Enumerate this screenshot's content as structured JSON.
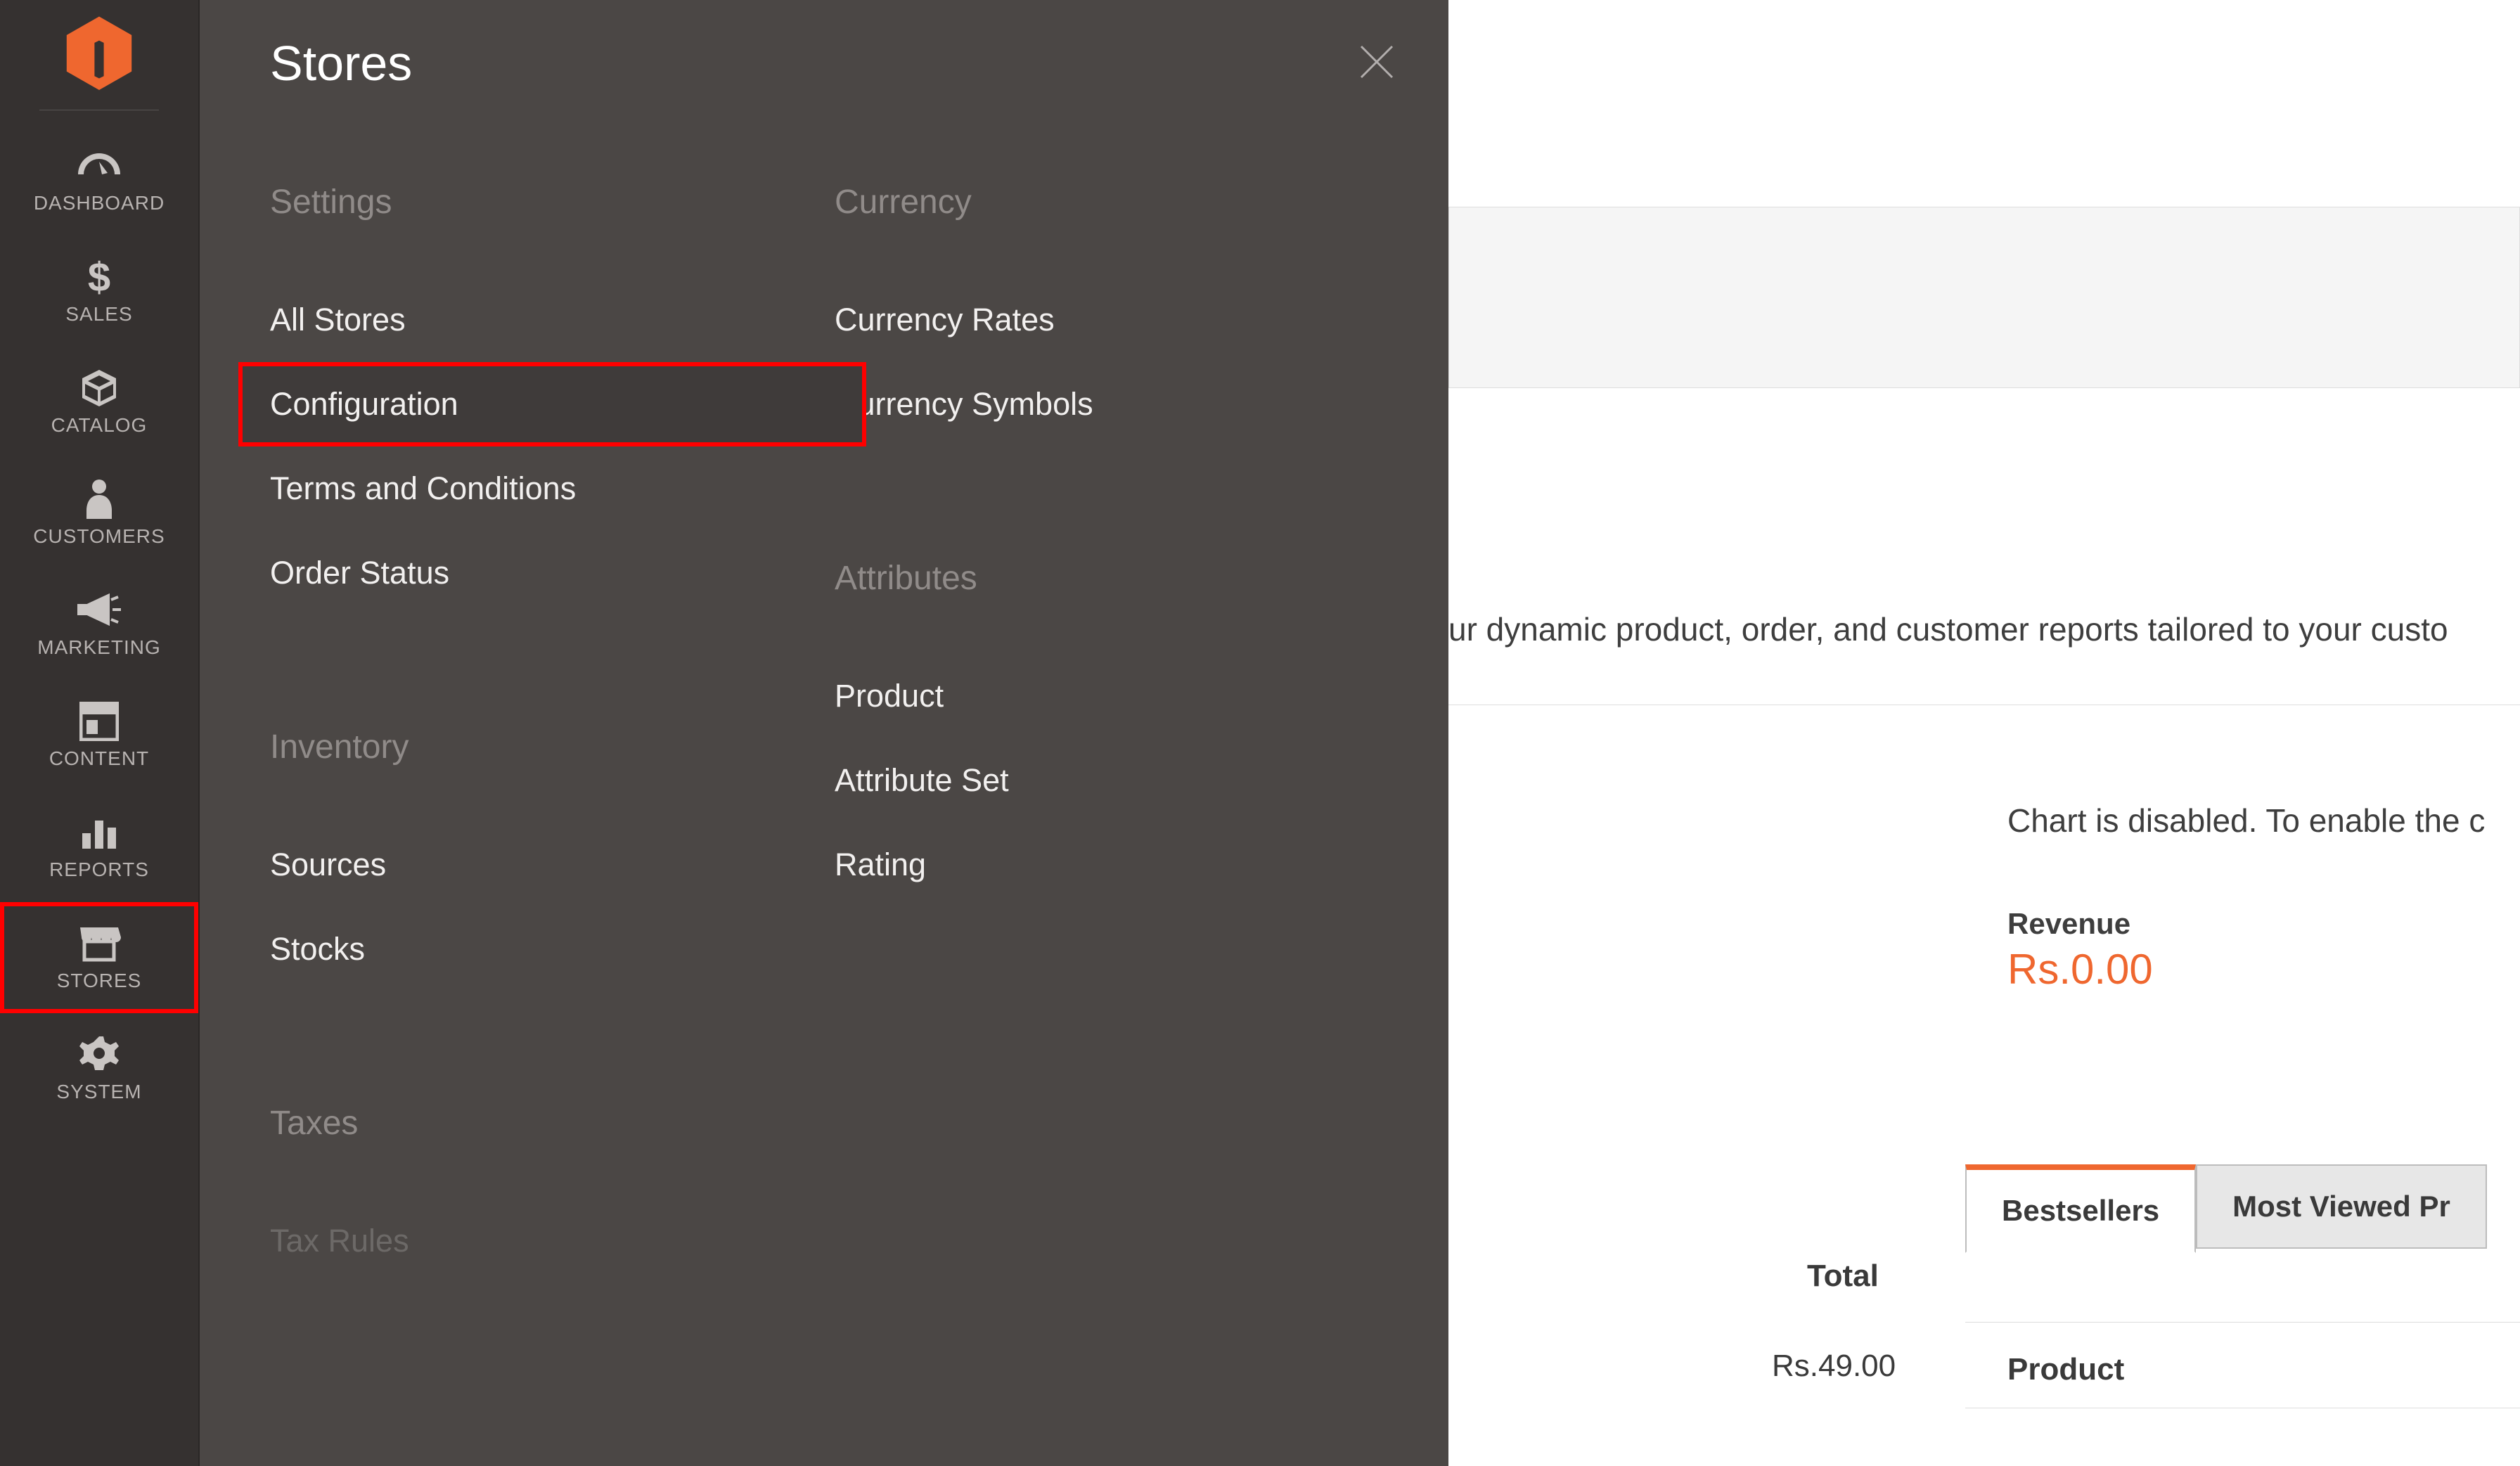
{
  "flyout_title": "Stores",
  "sidebar": {
    "items": [
      {
        "label": "DASHBOARD"
      },
      {
        "label": "SALES"
      },
      {
        "label": "CATALOG"
      },
      {
        "label": "CUSTOMERS"
      },
      {
        "label": "MARKETING"
      },
      {
        "label": "CONTENT"
      },
      {
        "label": "REPORTS"
      },
      {
        "label": "STORES"
      },
      {
        "label": "SYSTEM"
      }
    ]
  },
  "flyout": {
    "settings": {
      "heading": "Settings",
      "items": [
        "All Stores",
        "Configuration",
        "Terms and Conditions",
        "Order Status"
      ]
    },
    "inventory": {
      "heading": "Inventory",
      "items": [
        "Sources",
        "Stocks"
      ]
    },
    "taxes": {
      "heading": "Taxes",
      "items": [
        "Tax Rules"
      ]
    },
    "currency": {
      "heading": "Currency",
      "items": [
        "Currency Rates",
        "Currency Symbols"
      ]
    },
    "attributes": {
      "heading": "Attributes",
      "items": [
        "Product",
        "Attribute Set",
        "Rating"
      ]
    }
  },
  "main": {
    "bi_text": "ur dynamic product, order, and customer reports tailored to your custo",
    "chart_msg": "Chart is disabled. To enable the c",
    "revenue_label": "Revenue",
    "revenue_value": "Rs.0.00",
    "tabs": {
      "bestsellers": "Bestsellers",
      "most_viewed": "Most Viewed Pr"
    },
    "total_label": "Total",
    "total_value": "Rs.49.00",
    "product_head": "Product"
  }
}
